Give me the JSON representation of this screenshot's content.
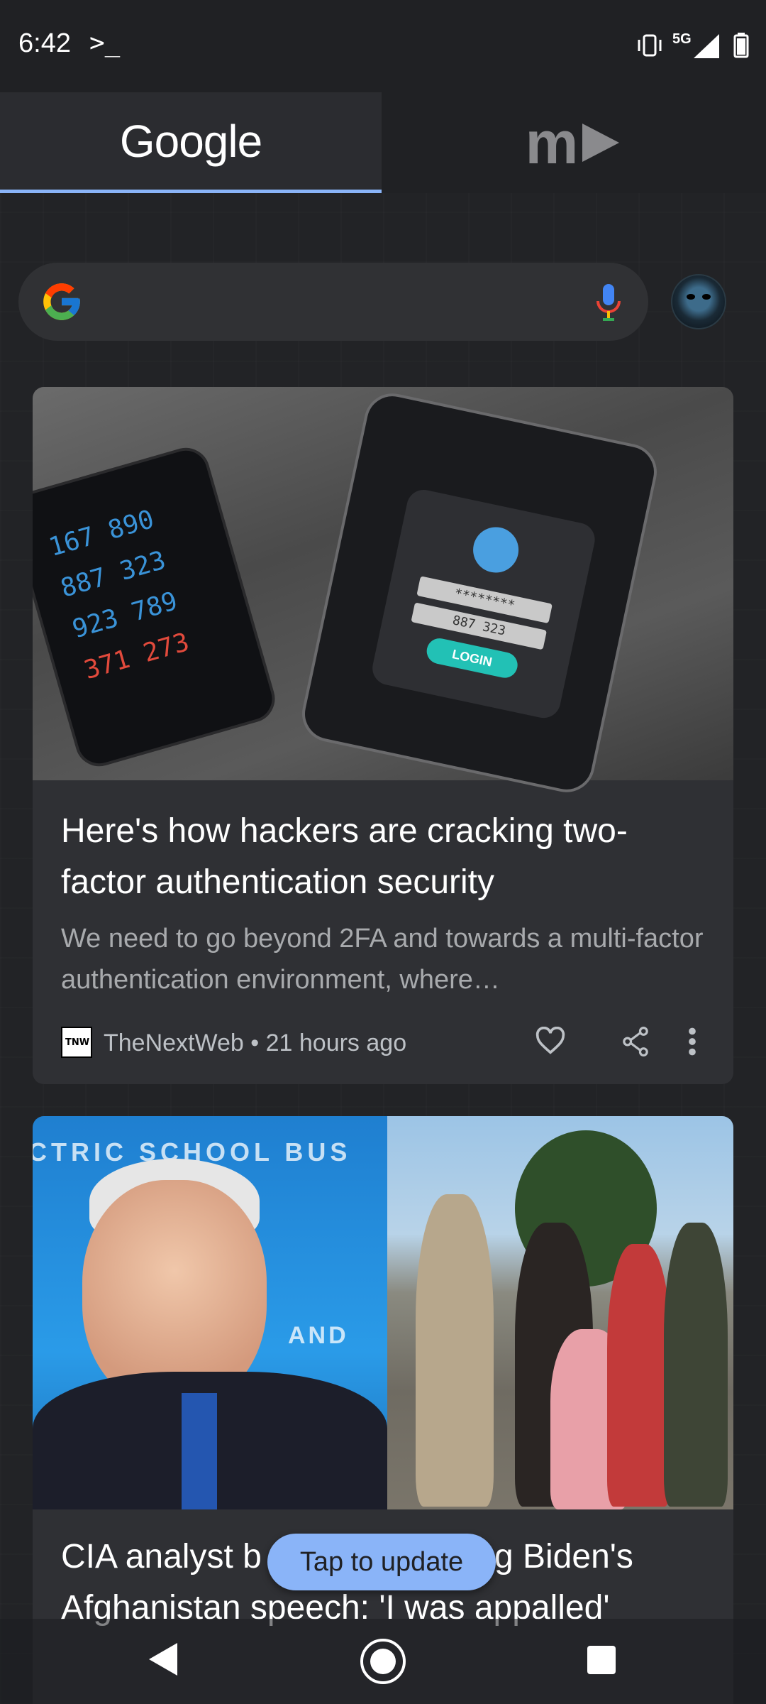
{
  "status_bar": {
    "time": "6:42",
    "terminal_glyph": ">_",
    "network": "5G"
  },
  "tabs": [
    {
      "label": "Google",
      "selected": true
    },
    {
      "label": "m",
      "selected": false
    }
  ],
  "search": {
    "logo": "google-g-icon",
    "mic": "mic-icon",
    "avatar": "account-avatar"
  },
  "feed": [
    {
      "image_text": {
        "numbers": [
          "167 890",
          "887 323",
          "923 789",
          "371 273"
        ],
        "password_mask": "********",
        "code": "887 323",
        "button": "LOGIN"
      },
      "title": "Here's how hackers are cracking two-factor authentication security",
      "snippet": "We need to go beyond 2FA and towards a multi-factor authentication environment, where…",
      "source_logo_text": "TNW",
      "source": "TheNextWeb",
      "separator": "•",
      "time": "21 hours ago"
    },
    {
      "image_text": {
        "banner": "CTRIC SCHOOL BUS",
        "sign": "AND"
      },
      "title": "CIA analyst b          C for supporting Biden's Afghanistan speech: 'I was appalled'"
    }
  ],
  "update_pill": "Tap to update",
  "colors": {
    "accent": "#8ab4f8",
    "background": "#202124",
    "card": "#2f3034"
  }
}
